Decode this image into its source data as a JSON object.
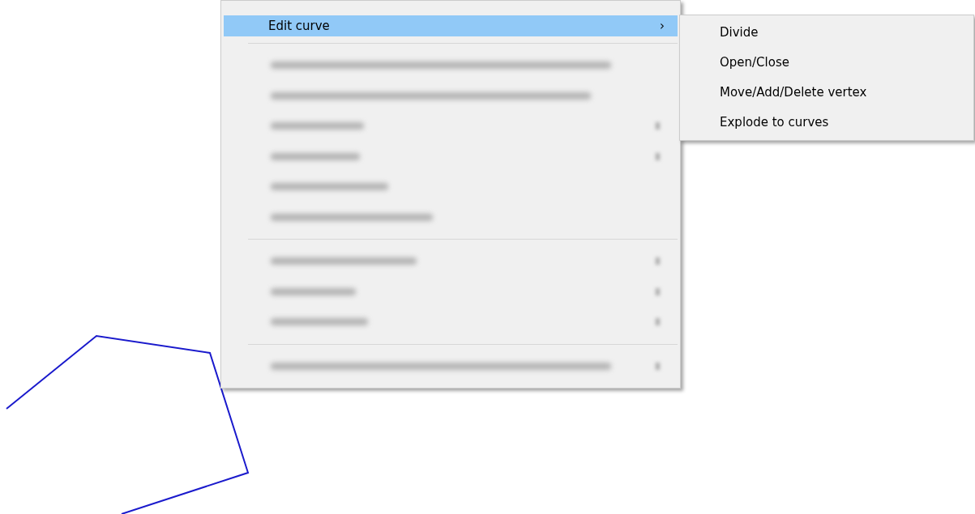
{
  "context_menu": {
    "items": [
      {
        "kind": "item",
        "label": "Edit curve",
        "arrow": "›",
        "selected": true
      },
      {
        "kind": "separator"
      },
      {
        "kind": "blurred",
        "has_submenu": false
      },
      {
        "kind": "blurred",
        "has_submenu": false
      },
      {
        "kind": "blurred",
        "has_submenu": true
      },
      {
        "kind": "blurred",
        "has_submenu": true
      },
      {
        "kind": "blurred",
        "has_submenu": false
      },
      {
        "kind": "blurred",
        "has_submenu": false
      },
      {
        "kind": "separator"
      },
      {
        "kind": "blurred",
        "has_submenu": true
      },
      {
        "kind": "blurred",
        "has_submenu": true
      },
      {
        "kind": "blurred",
        "has_submenu": true
      },
      {
        "kind": "separator"
      },
      {
        "kind": "blurred",
        "has_submenu": true
      }
    ]
  },
  "submenu": {
    "items": [
      {
        "label": "Divide"
      },
      {
        "label": "Open/Close"
      },
      {
        "label": "Move/Add/Delete vertex"
      },
      {
        "label": "Explode to curves"
      }
    ]
  }
}
